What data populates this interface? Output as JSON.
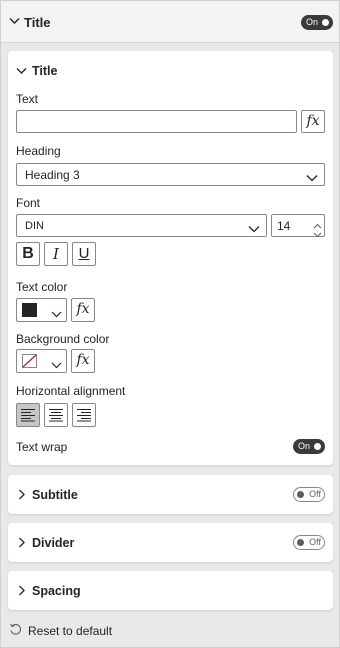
{
  "header": {
    "title": "Title",
    "toggle": "On"
  },
  "title_card": {
    "title": "Title",
    "text_label": "Text",
    "text_value": "",
    "fx": "fx",
    "heading_label": "Heading",
    "heading_value": "Heading 3",
    "font_label": "Font",
    "font_value": "DIN",
    "font_size": "14",
    "bold": "B",
    "italic": "I",
    "underline": "U",
    "text_color_label": "Text color",
    "text_color": "#252423",
    "background_color_label": "Background color",
    "horizontal_alignment_label": "Horizontal alignment",
    "text_wrap_label": "Text wrap",
    "text_wrap_toggle": "On"
  },
  "subtitle_card": {
    "title": "Subtitle",
    "toggle": "Off"
  },
  "divider_card": {
    "title": "Divider",
    "toggle": "Off"
  },
  "spacing_card": {
    "title": "Spacing"
  },
  "footer": {
    "reset_label": "Reset to default"
  }
}
